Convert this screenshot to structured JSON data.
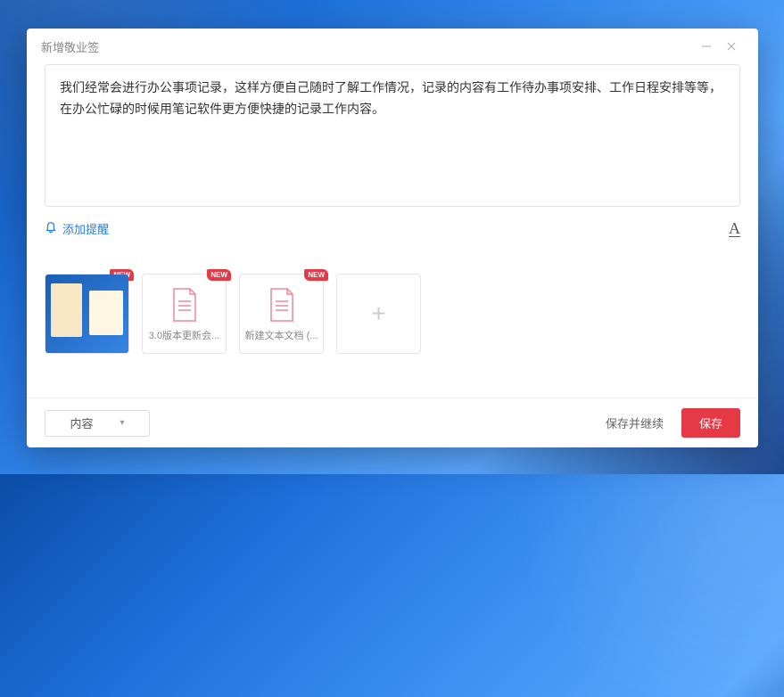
{
  "dialog": {
    "title": "新增敬业签",
    "textarea_value": "我们经常会进行办公事项记录，这样方便自己随时了解工作情况，记录的内容有工作待办事项安排、工作日程安排等等，在办公忙碌的时候用笔记软件更方便快捷的记录工作内容。",
    "reminder_label": "添加提醒",
    "font_label": "A"
  },
  "attachments": {
    "badge": "NEW",
    "items": [
      {
        "type": "image",
        "caption": ""
      },
      {
        "type": "doc",
        "caption": "3.0版本更新会..."
      },
      {
        "type": "doc",
        "caption": "新建文本文档 (..."
      }
    ],
    "add_label": "+"
  },
  "footer": {
    "select_value": "内容",
    "save_continue_label": "保存并继续",
    "save_label": "保存"
  }
}
